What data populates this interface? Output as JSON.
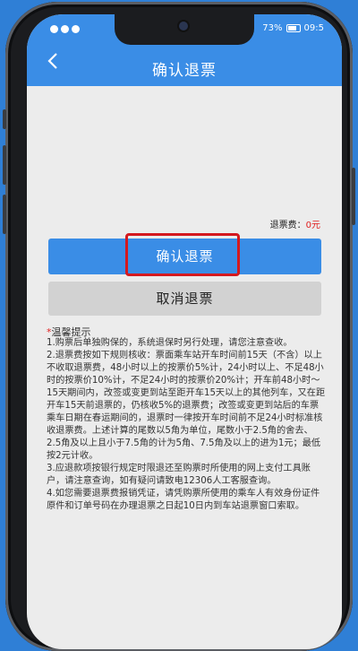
{
  "status_bar": {
    "battery": "73%",
    "time": "09:5"
  },
  "header": {
    "title": "确认退票"
  },
  "refund": {
    "label": "退票费：",
    "amount": "0元"
  },
  "buttons": {
    "confirm": "确认退票",
    "cancel": "取消退票"
  },
  "tips": {
    "star": "*",
    "title": "温馨提示",
    "items": [
      "1.购票后单独购保的，系统退保时另行处理，请您注意查收。",
      "2.退票费按如下规则核收：票面乘车站开车时间前15天（不含）以上不收取退票费，48小时以上的按票价5%计，24小时以上、不足48小时的按票价10%计，不足24小时的按票价20%计；开车前48小时～15天期间内，改签或变更到站至距开车15天以上的其他列车，又在距开车15天前退票的，仍核收5%的退票费；改签或变更到站后的车票乘车日期在春运期间的，退票时一律按开车时间前不足24小时标准核收退票费。上述计算的尾数以5角为单位，尾数小于2.5角的舍去、2.5角及以上且小于7.5角的计为5角、7.5角及以上的进为1元；最低按2元计收。",
      "3.应退款项按银行规定时限退还至购票时所使用的网上支付工具账户，请注意查询，如有疑问请致电12306人工客服查询。",
      "4.如您需要退票费报销凭证，请凭购票所使用的乘车人有效身份证件原件和订单号码在办理退票之日起10日内到车站退票窗口索取。"
    ]
  }
}
